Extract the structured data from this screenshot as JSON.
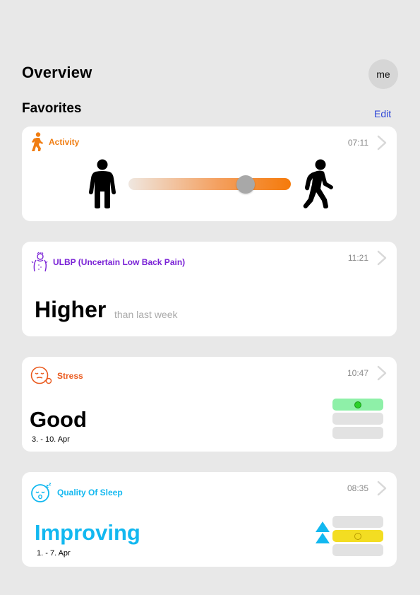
{
  "header": {
    "title": "Overview",
    "avatar_label": "me"
  },
  "favorites": {
    "title": "Favorites",
    "edit_label": "Edit"
  },
  "colors": {
    "activity": "#f07d12",
    "ulbp": "#7a22d6",
    "stress": "#ea5a1e",
    "sleep": "#12b8f0",
    "link": "#2f47d8"
  },
  "cards": {
    "activity": {
      "label": "Activity",
      "time": "07:11",
      "icon": "walking-person-icon",
      "level_percent": 72
    },
    "ulbp": {
      "label": "ULBP (Uncertain Low Back Pain)",
      "time": "11:21",
      "icon": "back-pain-icon",
      "value": "Higher",
      "comparison": "than last week"
    },
    "stress": {
      "label": "Stress",
      "time": "10:47",
      "icon": "stress-face-icon",
      "value": "Good",
      "date_range": "3. - 10. Apr",
      "active_level": 1
    },
    "sleep": {
      "label": "Quality Of Sleep",
      "time": "08:35",
      "icon": "sleeping-face-icon",
      "value": "Improving",
      "date_range": "1. - 7. Apr",
      "active_level": 2,
      "trend": "up"
    }
  }
}
